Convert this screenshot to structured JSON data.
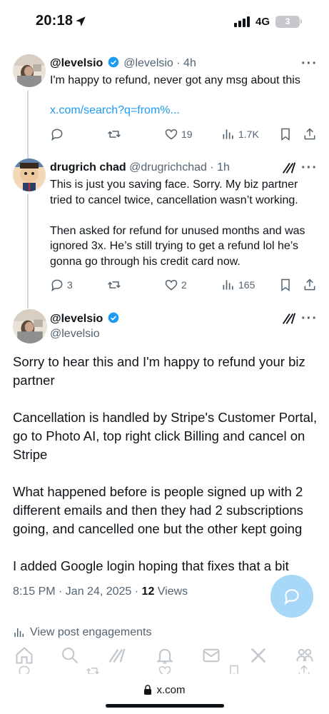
{
  "status_bar": {
    "time": "20:18",
    "network": "4G",
    "battery": "3"
  },
  "tweets": [
    {
      "display_name": "@levelsio",
      "handle_time": "@levelsio · 4h",
      "text": "I'm happy to refund, never got any msg about this",
      "link": "x.com/search?q=from%...",
      "replies": "",
      "retweets": "",
      "likes": "19",
      "views": "1.7K"
    },
    {
      "display_name": "drugrich chad",
      "handle_time": "@drugrichchad · 1h",
      "text_lines": [
        "This is just you saving face. Sorry. My biz partner",
        "tried to cancel twice, cancellation wasn’t working.",
        "",
        "Then asked for refund for unused months and was",
        "ignored 3x. He’s still trying to get a refund lol he’s",
        "gonna go through his credit card now."
      ],
      "replies": "3",
      "retweets": "",
      "likes": "2",
      "views": "165"
    }
  ],
  "main_tweet": {
    "display_name": "@levelsio",
    "handle": "@levelsio",
    "paragraphs": [
      "Sorry to hear this and I'm happy to refund your biz partner",
      "Cancellation is handled by Stripe's Customer Portal, go to Photo AI, top right click Billing and cancel on Stripe",
      "What happened before is people signed up with 2 different emails and then they had 2 subscriptions going, and cancelled one but the other kept going",
      "I added Google login hoping that fixes that a bit"
    ],
    "timestamp": "8:15 PM · Jan 24, 2025 · ",
    "views_count": "12",
    "views_label": " Views",
    "engagements": "View post engagements"
  },
  "browser": {
    "url": "x.com"
  },
  "colors": {
    "accent": "#1d9bf0",
    "muted": "#536471",
    "text": "#0f1419",
    "fab": "#a8d8f8"
  }
}
